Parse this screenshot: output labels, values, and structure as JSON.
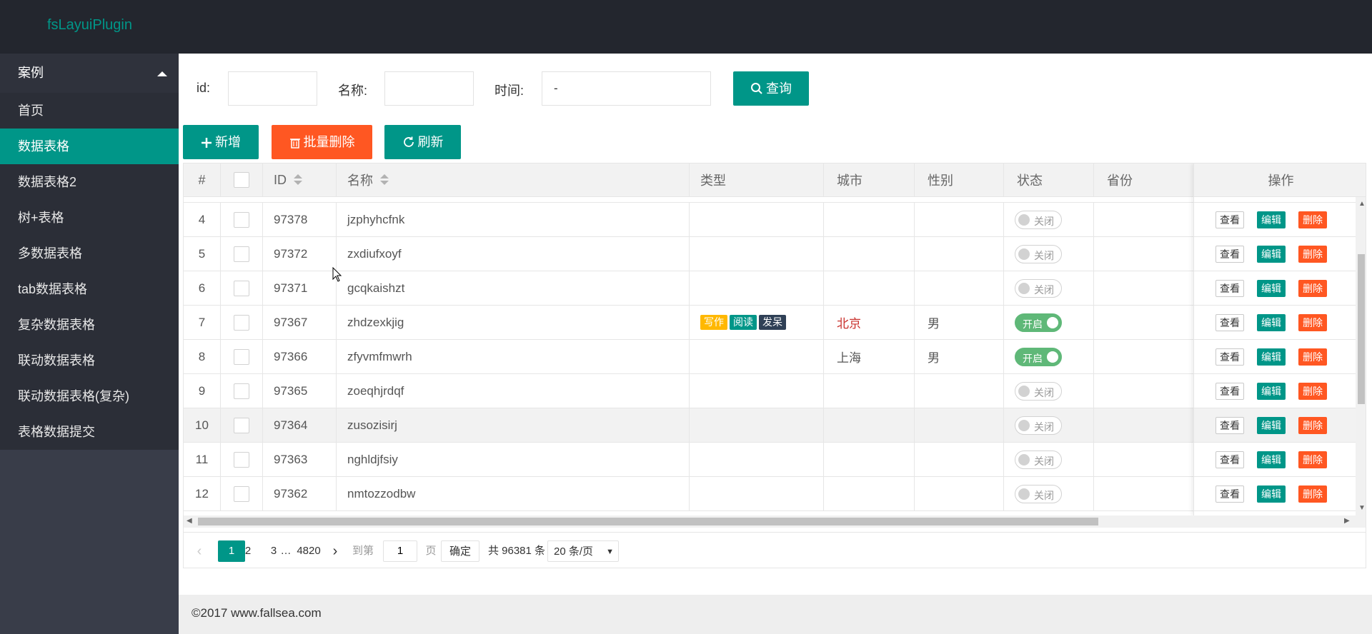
{
  "app": {
    "logo": "fsLayuiPlugin"
  },
  "sidebar": {
    "group": "案例",
    "items": [
      {
        "label": "首页",
        "active": false
      },
      {
        "label": "数据表格",
        "active": true
      },
      {
        "label": "数据表格2",
        "active": false
      },
      {
        "label": "树+表格",
        "active": false
      },
      {
        "label": "多数据表格",
        "active": false
      },
      {
        "label": "tab数据表格",
        "active": false
      },
      {
        "label": "复杂数据表格",
        "active": false
      },
      {
        "label": "联动数据表格",
        "active": false
      },
      {
        "label": "联动数据表格(复杂)",
        "active": false
      },
      {
        "label": "表格数据提交",
        "active": false
      }
    ]
  },
  "search": {
    "id_label": "id:",
    "id_value": "",
    "name_label": "名称:",
    "name_value": "",
    "time_label": "时间:",
    "time_value": "-",
    "query_label": "查询"
  },
  "toolbar": {
    "add_label": "新增",
    "batch_delete_label": "批量删除",
    "refresh_label": "刷新"
  },
  "table": {
    "columns": {
      "index": "#",
      "id": "ID",
      "name": "名称",
      "type": "类型",
      "city": "城市",
      "gender": "性别",
      "status": "状态",
      "province": "省份",
      "actions": "操作"
    },
    "rows": [
      {
        "index": "4",
        "id": "97378",
        "name": "jzphyhcfnk",
        "tags": [],
        "city": "",
        "gender": "",
        "status": "关闭",
        "on": false
      },
      {
        "index": "5",
        "id": "97372",
        "name": "zxdiufxoyf",
        "tags": [],
        "city": "",
        "gender": "",
        "status": "关闭",
        "on": false
      },
      {
        "index": "6",
        "id": "97371",
        "name": "gcqkaishzt",
        "tags": [],
        "city": "",
        "gender": "",
        "status": "关闭",
        "on": false
      },
      {
        "index": "7",
        "id": "97367",
        "name": "zhdzexkjig",
        "tags": [
          {
            "label": "写作",
            "color": "#ffb800"
          },
          {
            "label": "阅读",
            "color": "#009688"
          },
          {
            "label": "发呆",
            "color": "#2f4056"
          }
        ],
        "city": "北京",
        "city_color": "#c9302c",
        "gender": "男",
        "status": "开启",
        "on": true
      },
      {
        "index": "8",
        "id": "97366",
        "name": "zfyvmfmwrh",
        "tags": [],
        "city": "上海",
        "city_color": "#555555",
        "gender": "男",
        "status": "开启",
        "on": true
      },
      {
        "index": "9",
        "id": "97365",
        "name": "zoeqhjrdqf",
        "tags": [],
        "city": "",
        "gender": "",
        "status": "关闭",
        "on": false
      },
      {
        "index": "10",
        "id": "97364",
        "name": "zusozisirj",
        "tags": [],
        "city": "",
        "gender": "",
        "status": "关闭",
        "on": false,
        "hover": true
      },
      {
        "index": "11",
        "id": "97363",
        "name": "nghldjfsiy",
        "tags": [],
        "city": "",
        "gender": "",
        "status": "关闭",
        "on": false
      },
      {
        "index": "12",
        "id": "97362",
        "name": "nmtozzodbw",
        "tags": [],
        "city": "",
        "gender": "",
        "status": "关闭",
        "on": false
      }
    ],
    "actions": {
      "view": "查看",
      "edit": "编辑",
      "delete": "删除"
    }
  },
  "pager": {
    "current": "1",
    "pages": [
      "2",
      "3"
    ],
    "ellipsis": "…",
    "last": "4820",
    "goto_label": "到第",
    "goto_value": "1",
    "page_unit": "页",
    "confirm": "确定",
    "total": "共 96381 条",
    "page_size": "20 条/页"
  },
  "footer": {
    "copyright": "©2017 www.fallsea.com"
  },
  "colors": {
    "primary": "#009688",
    "danger": "#ff5722",
    "warm": "#ffb800",
    "dark": "#2f4056",
    "switch_on": "#5fb878"
  }
}
